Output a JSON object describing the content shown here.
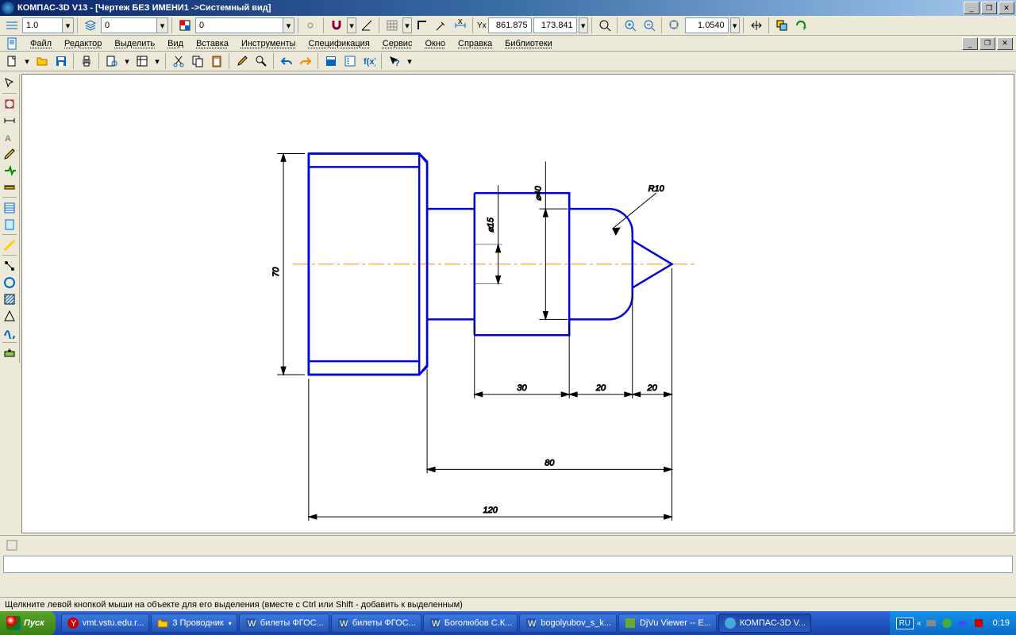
{
  "title": "КОМПАС-3D V13 - [Чертеж БЕЗ ИМЕНИ1 ->Системный вид]",
  "toolbar1": {
    "style_val": "1.0",
    "layer_val": "0",
    "color_val": "0",
    "coord_x": "861.875",
    "coord_y": "173.841",
    "zoom": "1.0540"
  },
  "menu": {
    "file": "Файл",
    "edit": "Редактор",
    "select": "Выделить",
    "view": "Вид",
    "insert": "Вставка",
    "tools": "Инструменты",
    "spec": "Спецификация",
    "service": "Сервис",
    "window": "Окно",
    "help": "Справка",
    "libs": "Библиотеки"
  },
  "drawing": {
    "dims": {
      "d70": "70",
      "d30": "30",
      "d20a": "20",
      "d20b": "20",
      "d80": "80",
      "d120": "120",
      "phi40": "⌀40",
      "phi15": "⌀15",
      "r10": "R10"
    }
  },
  "status": "Щелкните левой кнопкой мыши на объекте для его выделения (вместе с Ctrl или Shift - добавить к выделенным)",
  "taskbar": {
    "start": "Пуск",
    "items": [
      "vmt.vstu.edu.r...",
      "3 Проводник",
      "билеты ФГОС...",
      "билеты ФГОС...",
      "Боголюбов С.К...",
      "bogolyubov_s_k...",
      "DjVu Viewer -- E...",
      "КОМПАС-3D V..."
    ],
    "lang": "RU",
    "clock": "0:19"
  }
}
